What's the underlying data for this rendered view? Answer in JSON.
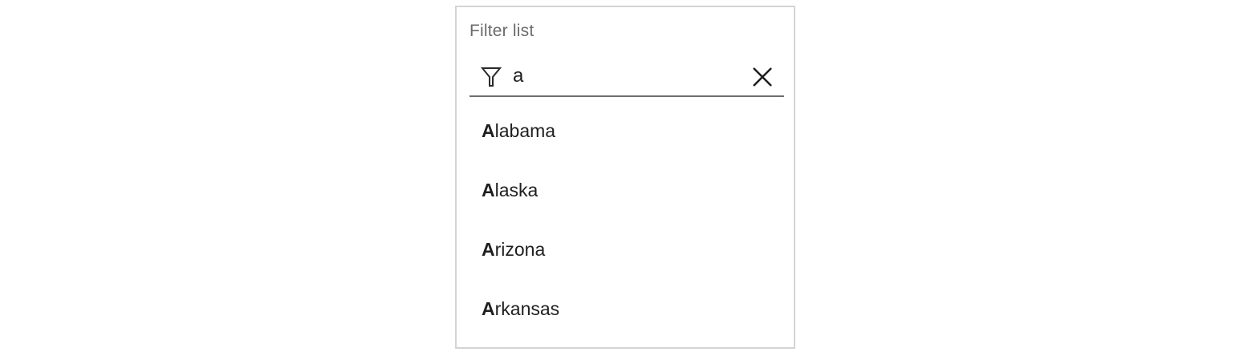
{
  "filter": {
    "title": "Filter list",
    "input_value": "a",
    "icon": "filter-icon",
    "clear_icon": "close-icon"
  },
  "results": [
    {
      "match": "A",
      "rest": "labama"
    },
    {
      "match": "A",
      "rest": "laska"
    },
    {
      "match": "A",
      "rest": "rizona"
    },
    {
      "match": "A",
      "rest": "rkansas"
    }
  ],
  "colors": {
    "border": "#d4d4d4",
    "underline": "#6e6e6e",
    "title": "#6b6b6b",
    "text": "#1f1f1f"
  }
}
